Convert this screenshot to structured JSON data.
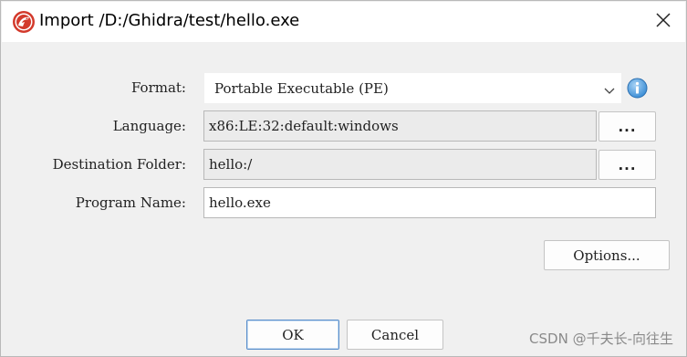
{
  "window": {
    "title": "Import /D:/Ghidra/test/hello.exe",
    "app_icon": "ghidra-dragon-icon",
    "close_icon": "close-icon"
  },
  "form": {
    "format": {
      "label": "Format:",
      "value": "Portable Executable (PE)"
    },
    "language": {
      "label": "Language:",
      "value": "x86:LE:32:default:windows",
      "browse_label": "..."
    },
    "destination": {
      "label": "Destination Folder:",
      "value": "hello:/",
      "browse_label": "..."
    },
    "program_name": {
      "label": "Program Name:",
      "value": "hello.exe"
    }
  },
  "buttons": {
    "options": "Options...",
    "ok": "OK",
    "cancel": "Cancel"
  },
  "watermark": "CSDN @千夫长-向往生",
  "colors": {
    "info_icon": "#3d8fd6",
    "default_button_border": "#5a8ecb",
    "app_icon_red": "#d33a2c"
  }
}
